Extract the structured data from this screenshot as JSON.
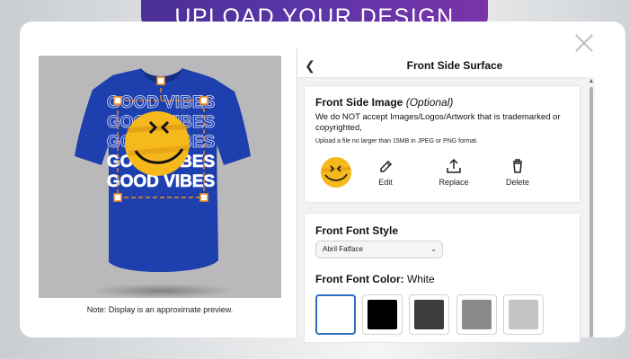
{
  "banner": {
    "title": "UPLOAD YOUR DESIGN"
  },
  "preview": {
    "note": "Note: Display is an approximate preview.",
    "shirt_color": "#1e3fae",
    "design_text": "GOOD VIBES"
  },
  "panel": {
    "title": "Front Side Surface",
    "image_card": {
      "title": "Front Side Image",
      "optional": "(Optional)",
      "warning": "We do NOT accept Images/Logos/Artwork that is trademarked or copyrighted,",
      "hint": "Upload a file no larger than 15MB in JPEG or PNG format.",
      "actions": [
        {
          "label": "Edit",
          "icon": "pencil-icon"
        },
        {
          "label": "Replace",
          "icon": "upload-icon"
        },
        {
          "label": "Delete",
          "icon": "trash-icon"
        }
      ]
    },
    "font_card": {
      "style_title": "Front Font Style",
      "style_value": "Abril Fatface",
      "color_title": "Front Font Color:",
      "color_value": "White",
      "swatches": [
        {
          "name": "White",
          "color": "#ffffff",
          "selected": true
        },
        {
          "name": "Black",
          "color": "#000000"
        },
        {
          "name": "Dark Gray",
          "color": "#3c3c3c"
        },
        {
          "name": "Gray",
          "color": "#8a8a8a"
        },
        {
          "name": "Light Gray",
          "color": "#c4c4c4"
        }
      ]
    }
  },
  "colors": {
    "banner_start": "#4b2f96",
    "banner_end": "#7a33a9",
    "selected_border": "#2f6fbd",
    "smiley": "#f5b91c",
    "handle": "#f28a1e"
  }
}
